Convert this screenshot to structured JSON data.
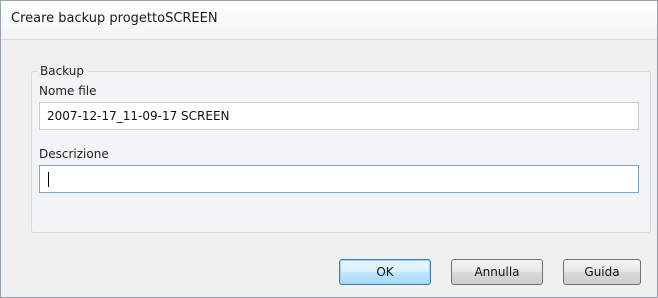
{
  "window": {
    "title": "Creare backup progettoSCREEN"
  },
  "group": {
    "label": "Backup"
  },
  "fields": {
    "filename": {
      "label": "Nome file",
      "value": "2007-12-17_11-09-17 SCREEN"
    },
    "description": {
      "label": "Descrizione",
      "value": ""
    }
  },
  "buttons": {
    "ok": "OK",
    "cancel": "Annulla",
    "help": "Guida"
  }
}
